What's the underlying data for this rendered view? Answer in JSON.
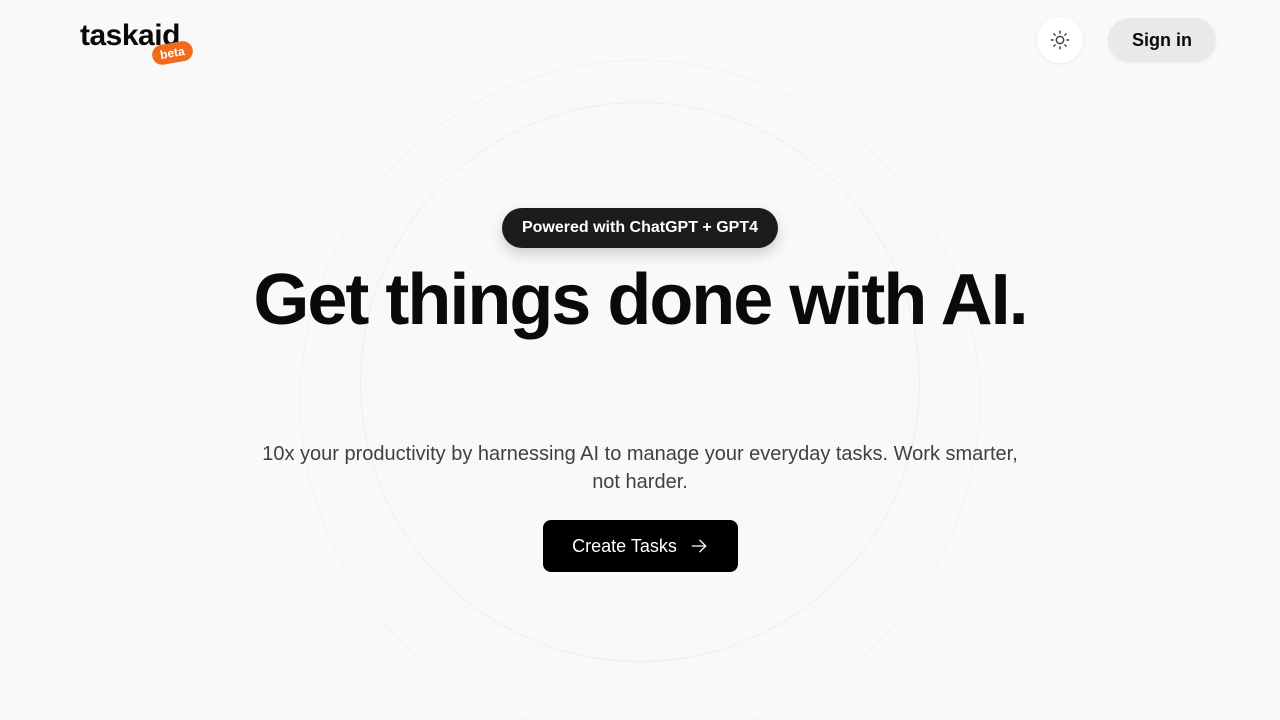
{
  "header": {
    "logo_text": "taskaid",
    "beta_label": "beta",
    "signin_label": "Sign in"
  },
  "hero": {
    "badge_text": "Powered with ChatGPT + GPT4",
    "title": "Get things done with AI.",
    "subtitle": "10x your productivity by harnessing AI to manage your everyday tasks. Work smarter, not harder.",
    "cta_label": "Create Tasks"
  },
  "icons": {
    "theme_toggle": "sun-icon",
    "cta_arrow": "arrow-right-icon"
  },
  "colors": {
    "background": "#f9f9f9",
    "beta_badge": "#f26b1d",
    "primary_button": "#000000",
    "signin_button": "#e8e9eb",
    "pill": "#1c1c1c"
  }
}
